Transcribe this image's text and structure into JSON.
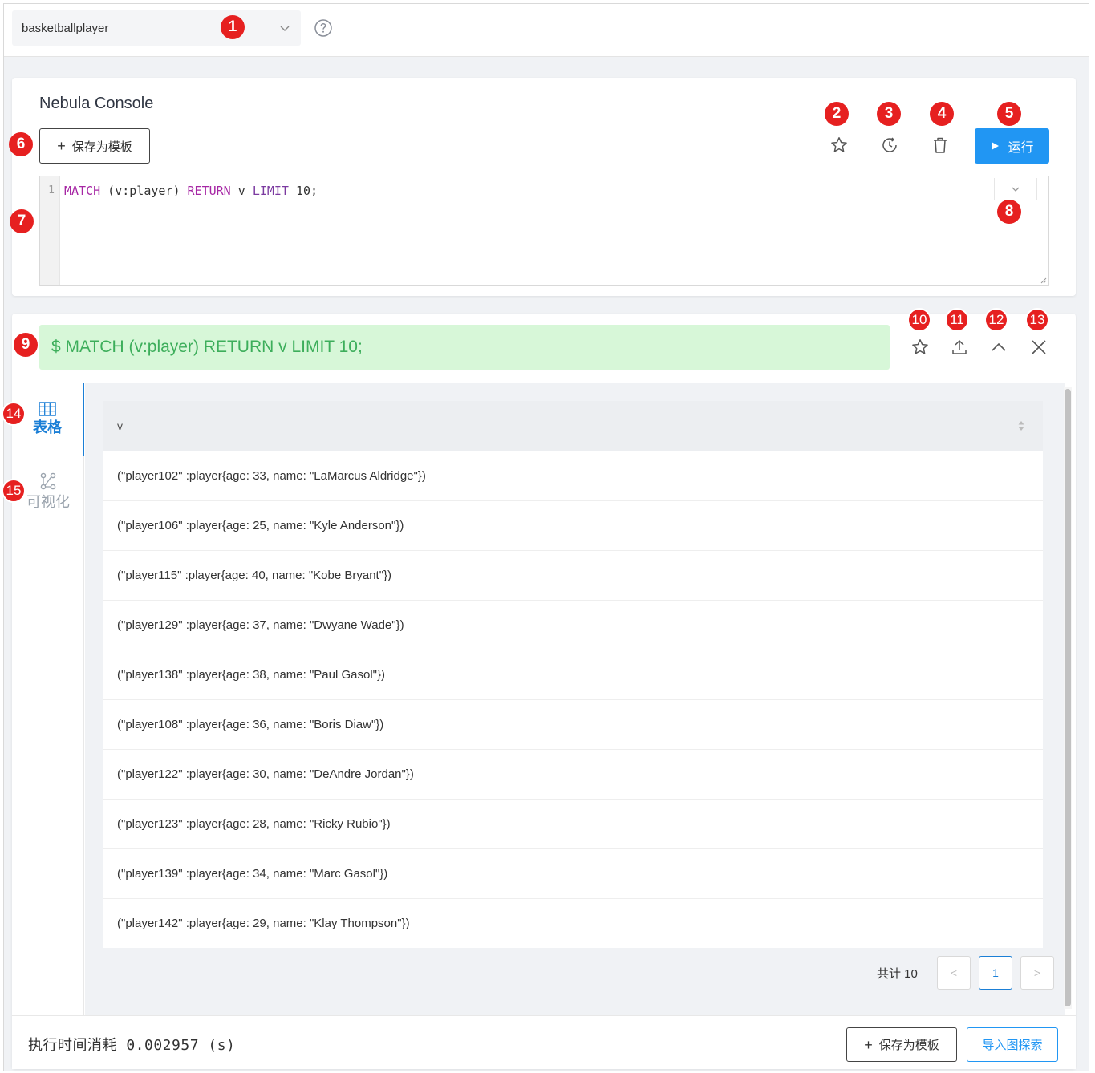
{
  "topbar": {
    "space_value": "basketballplayer",
    "help_icon": "question-circle-icon"
  },
  "console": {
    "title": "Nebula Console",
    "save_template_label": "保存为模板",
    "run_label": "运行",
    "editor": {
      "line_number": "1",
      "code_tokens": [
        {
          "text": "MATCH",
          "kind": "keyword"
        },
        {
          "text": " (v:player) ",
          "kind": "plain"
        },
        {
          "text": "RETURN",
          "kind": "keyword"
        },
        {
          "text": " v ",
          "kind": "plain"
        },
        {
          "text": "LIMIT",
          "kind": "keyword2"
        },
        {
          "text": " 10;",
          "kind": "plain"
        }
      ]
    }
  },
  "result": {
    "query_text": "$ MATCH (v:player) RETURN v LIMIT 10;",
    "tabs": [
      {
        "label": "表格",
        "icon": "table-icon",
        "active": true
      },
      {
        "label": "可视化",
        "icon": "graph-icon",
        "active": false
      }
    ],
    "table": {
      "columns": [
        "v"
      ],
      "rows": [
        "(\"player102\" :player{age: 33, name: \"LaMarcus Aldridge\"})",
        "(\"player106\" :player{age: 25, name: \"Kyle Anderson\"})",
        "(\"player115\" :player{age: 40, name: \"Kobe Bryant\"})",
        "(\"player129\" :player{age: 37, name: \"Dwyane Wade\"})",
        "(\"player138\" :player{age: 38, name: \"Paul Gasol\"})",
        "(\"player108\" :player{age: 36, name: \"Boris Diaw\"})",
        "(\"player122\" :player{age: 30, name: \"DeAndre Jordan\"})",
        "(\"player123\" :player{age: 28, name: \"Ricky Rubio\"})",
        "(\"player139\" :player{age: 34, name: \"Marc Gasol\"})",
        "(\"player142\" :player{age: 29, name: \"Klay Thompson\"})"
      ]
    },
    "pagination": {
      "total_label": "共计 10",
      "prev": "<",
      "current_page": "1",
      "next": ">"
    },
    "footer": {
      "exec_time": "执行时间消耗 0.002957 (s)",
      "save_template_label": "保存为模板",
      "import_explore_label": "导入图探索"
    }
  },
  "annotations": [
    "1",
    "2",
    "3",
    "4",
    "5",
    "6",
    "7",
    "8",
    "9",
    "10",
    "11",
    "12",
    "13",
    "14",
    "15"
  ],
  "colors": {
    "accent": "#2196f3",
    "badge": "#e62020",
    "query_bg": "#d7f7d8",
    "query_text": "#3dae5b",
    "keyword": "#a626a4"
  }
}
